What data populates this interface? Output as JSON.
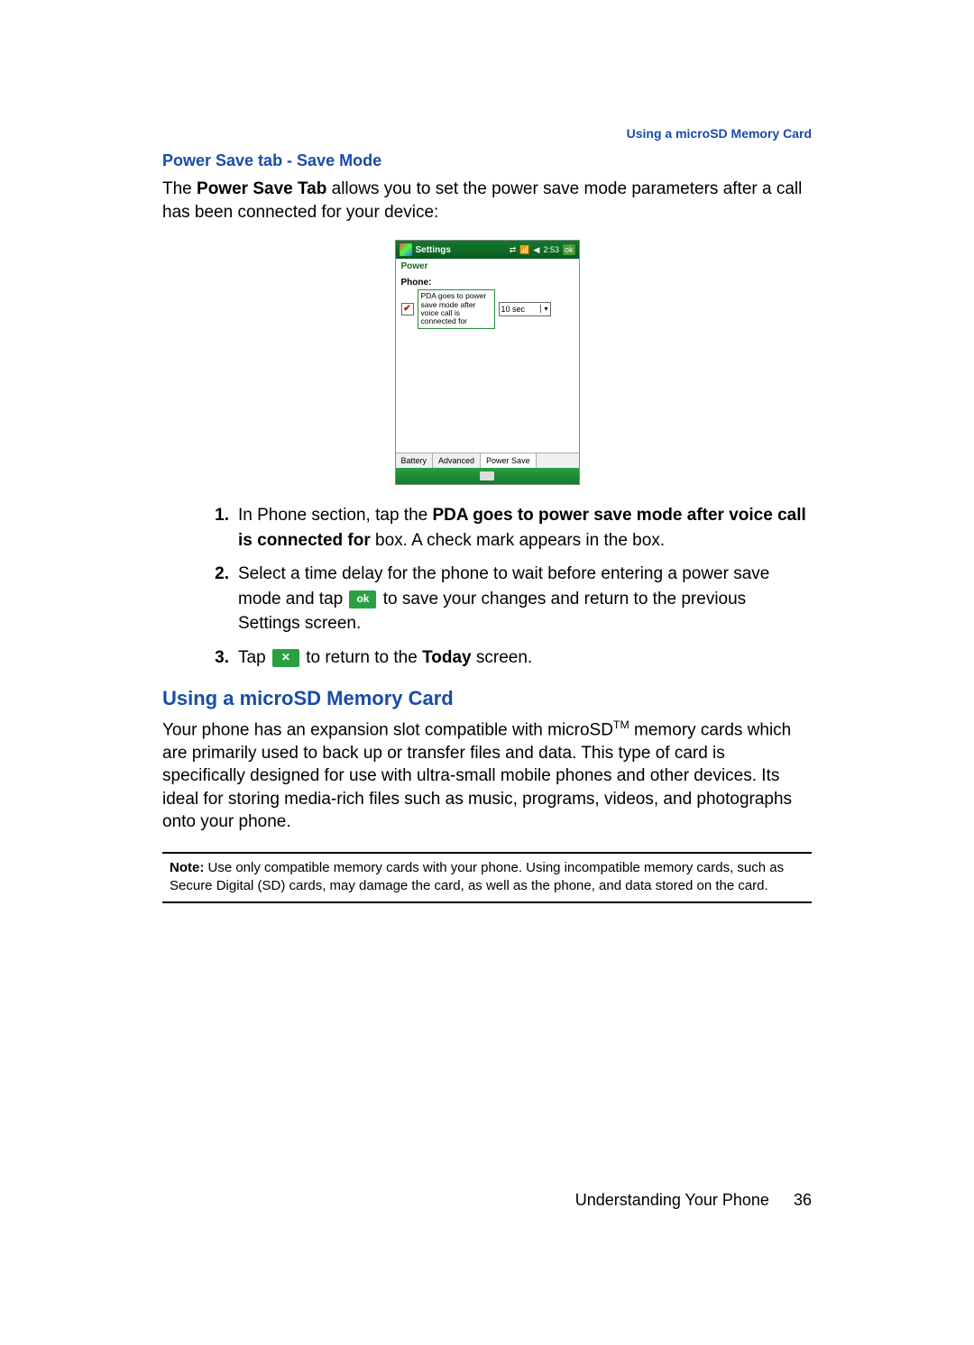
{
  "header": {
    "runningHead": "Using a microSD Memory Card"
  },
  "section1": {
    "heading": "Power Save tab - Save Mode",
    "intro_pre": "The ",
    "intro_bold": "Power Save Tab",
    "intro_post": " allows you to set the power save mode parameters after a call has been connected for your device:"
  },
  "screenshot": {
    "titlebar": "Settings",
    "time": "2:53",
    "okBtn": "ok",
    "subtitle": "Power",
    "phoneLabel": "Phone:",
    "checkText": "PDA goes to power save mode after voice call is connected for",
    "selectValue": "10 sec",
    "tabs": [
      "Battery",
      "Advanced",
      "Power Save"
    ]
  },
  "steps": {
    "n1": "1.",
    "s1_a": "In Phone section, tap the ",
    "s1_b": "PDA goes to power save mode after voice call is connected for",
    "s1_c": " box. A check mark appears in the box.",
    "n2": "2.",
    "s2_a": "Select a time delay for the phone to wait before entering a power save mode and tap ",
    "s2_ok": "ok",
    "s2_b": " to save your changes and return to the previous Settings screen.",
    "n3": "3.",
    "s3_a": "Tap ",
    "s3_x": "✕",
    "s3_b": " to return to the ",
    "s3_bold": "Today",
    "s3_c": " screen."
  },
  "section2": {
    "heading": "Using a microSD Memory Card",
    "body_a": "Your phone has an expansion slot compatible with microSD",
    "body_tm": "TM",
    "body_b": " memory cards which are primarily used to back up or transfer files and data. This type of card is specifically designed for use with ultra-small mobile phones and other devices. Its ideal for storing media-rich files such as music, programs, videos, and photographs onto your phone."
  },
  "note": {
    "label": "Note:",
    "text": " Use only compatible memory cards with your phone. Using incompatible memory cards, such as Secure Digital (SD) cards, may damage the card, as well as the phone, and data stored on the card."
  },
  "footer": {
    "chapter": "Understanding Your Phone",
    "page": "36"
  }
}
